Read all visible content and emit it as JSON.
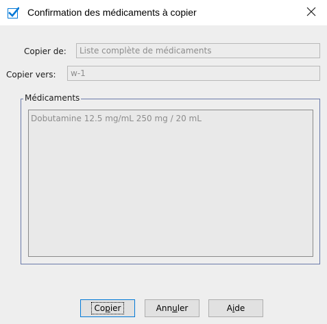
{
  "window": {
    "title": "Confirmation des médicaments à copier"
  },
  "form": {
    "copy_from_label": "Copier de:",
    "copy_from_value": "Liste complète de médicaments",
    "copy_to_label": "Copier vers:",
    "copy_to_value": "w-1"
  },
  "medications": {
    "group_label": "Médicaments",
    "items": [
      "Dobutamine 12.5 mg/mL 250 mg / 20 mL"
    ]
  },
  "buttons": {
    "copy": {
      "pre": "Co",
      "mnemonic": "p",
      "post": "ier"
    },
    "cancel": {
      "pre": "Ann",
      "mnemonic": "u",
      "post": "ler"
    },
    "help": {
      "pre": "A",
      "mnemonic": "i",
      "post": "de"
    }
  },
  "colors": {
    "accent": "#0078d7",
    "group_border": "#6878a8"
  },
  "icons": {
    "title_icon": "checkbox-checked-icon",
    "close": "close-icon"
  }
}
